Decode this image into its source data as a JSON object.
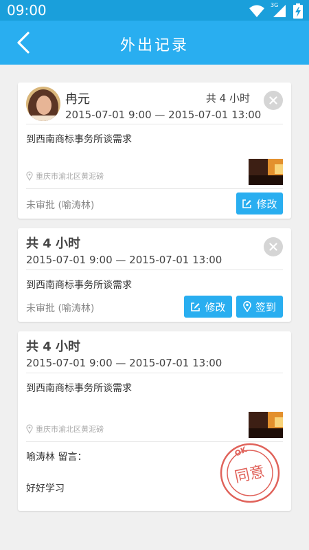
{
  "status_bar": {
    "time": "09:00",
    "network": "3G"
  },
  "header": {
    "title": "外出记录"
  },
  "records": [
    {
      "name": "冉元",
      "hours": "共 4 小时",
      "time_range": "2015-07-01 9:00 — 2015-07-01 13:00",
      "content": "到西南商标事务所谈需求",
      "address": "重庆市渝北区黄泥磅",
      "approval": "未审批 (喻涛林)",
      "edit_label": "修改"
    },
    {
      "hours": "共 4 小时",
      "time_range": "2015-07-01 9:00 — 2015-07-01 13:00",
      "content": "到西南商标事务所谈需求",
      "approval": "未审批 (喻涛林)",
      "edit_label": "修改",
      "checkin_label": "签到"
    },
    {
      "hours": "共 4 小时",
      "time_range": "2015-07-01 9:00 — 2015-07-01 13:00",
      "content": "到西南商标事务所谈需求",
      "address": "重庆市渝北区黄泥磅",
      "comment_label": "喻涛林 留言：",
      "comment_text": "好好学习",
      "stamp": {
        "top": "OK",
        "main": "同意",
        "color": "#e0625a"
      }
    }
  ],
  "colors": {
    "accent": "#29aef0",
    "status_bar": "#1a9fdb",
    "background": "#f0f0f0"
  }
}
